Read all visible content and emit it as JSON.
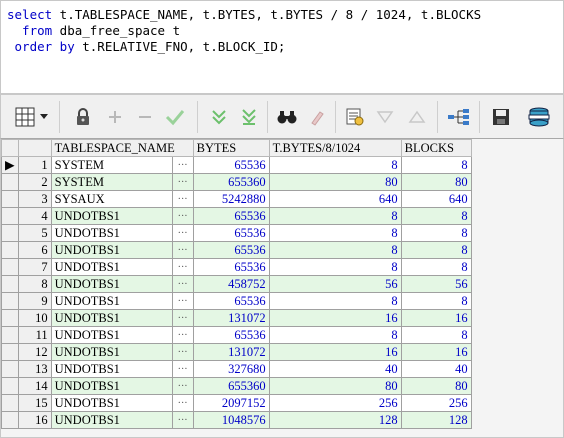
{
  "sql_editor": {
    "lines": [
      {
        "kw": "select",
        "rest": " t.TABLESPACE_NAME, t.BYTES, t.BYTES / 8 / 1024, t.BLOCKS"
      },
      {
        "kw": "  from",
        "rest": " dba_free_space t"
      },
      {
        "kw": " order by",
        "rest": " t.RELATIVE_FNO, t.BLOCK_ID;"
      }
    ]
  },
  "toolbar": {
    "buttons": [
      {
        "name": "grid-view-icon",
        "glyph": "▦"
      },
      {
        "name": "dropdown-arrow-icon",
        "glyph": "▾"
      },
      {
        "name": "lock-icon",
        "glyph": "🔒"
      },
      {
        "name": "add-row-icon",
        "glyph": "+"
      },
      {
        "name": "delete-row-icon",
        "glyph": "−"
      },
      {
        "name": "post-changes-icon",
        "glyph": "✓"
      },
      {
        "name": "fetch-next-icon",
        "glyph": "⩔"
      },
      {
        "name": "fetch-last-icon",
        "glyph": "⩔"
      },
      {
        "name": "binoculars-icon",
        "glyph": "⚲"
      },
      {
        "name": "clear-icon",
        "glyph": "✎"
      },
      {
        "name": "query-by-example-icon",
        "glyph": "▤"
      },
      {
        "name": "next-record-icon",
        "glyph": "▽"
      },
      {
        "name": "previous-record-icon",
        "glyph": "△"
      },
      {
        "name": "link-tree-icon",
        "glyph": "⊶"
      },
      {
        "name": "save-icon",
        "glyph": "▣"
      },
      {
        "name": "export-icon",
        "glyph": "⛁"
      }
    ]
  },
  "grid": {
    "columns": [
      "TABLESPACE_NAME",
      "BYTES",
      "T.BYTES/8/1024",
      "BLOCKS"
    ],
    "current_row_marker": "▶",
    "rows": [
      {
        "n": "1",
        "name": "SYSTEM",
        "bytes": "65536",
        "kb": "8",
        "blocks": "8"
      },
      {
        "n": "2",
        "name": "SYSTEM",
        "bytes": "655360",
        "kb": "80",
        "blocks": "80"
      },
      {
        "n": "3",
        "name": "SYSAUX",
        "bytes": "5242880",
        "kb": "640",
        "blocks": "640"
      },
      {
        "n": "4",
        "name": "UNDOTBS1",
        "bytes": "65536",
        "kb": "8",
        "blocks": "8"
      },
      {
        "n": "5",
        "name": "UNDOTBS1",
        "bytes": "65536",
        "kb": "8",
        "blocks": "8"
      },
      {
        "n": "6",
        "name": "UNDOTBS1",
        "bytes": "65536",
        "kb": "8",
        "blocks": "8"
      },
      {
        "n": "7",
        "name": "UNDOTBS1",
        "bytes": "65536",
        "kb": "8",
        "blocks": "8"
      },
      {
        "n": "8",
        "name": "UNDOTBS1",
        "bytes": "458752",
        "kb": "56",
        "blocks": "56"
      },
      {
        "n": "9",
        "name": "UNDOTBS1",
        "bytes": "65536",
        "kb": "8",
        "blocks": "8"
      },
      {
        "n": "10",
        "name": "UNDOTBS1",
        "bytes": "131072",
        "kb": "16",
        "blocks": "16"
      },
      {
        "n": "11",
        "name": "UNDOTBS1",
        "bytes": "65536",
        "kb": "8",
        "blocks": "8"
      },
      {
        "n": "12",
        "name": "UNDOTBS1",
        "bytes": "131072",
        "kb": "16",
        "blocks": "16"
      },
      {
        "n": "13",
        "name": "UNDOTBS1",
        "bytes": "327680",
        "kb": "40",
        "blocks": "40"
      },
      {
        "n": "14",
        "name": "UNDOTBS1",
        "bytes": "655360",
        "kb": "80",
        "blocks": "80"
      },
      {
        "n": "15",
        "name": "UNDOTBS1",
        "bytes": "2097152",
        "kb": "256",
        "blocks": "256"
      },
      {
        "n": "16",
        "name": "UNDOTBS1",
        "bytes": "1048576",
        "kb": "128",
        "blocks": "128"
      }
    ]
  },
  "colors": {
    "keyword": "#0000c8",
    "row_even": "#e4f7e4",
    "row_odd": "#ffffff",
    "check_green": "#9ad29a",
    "fetch_green": "#6cc06c"
  }
}
